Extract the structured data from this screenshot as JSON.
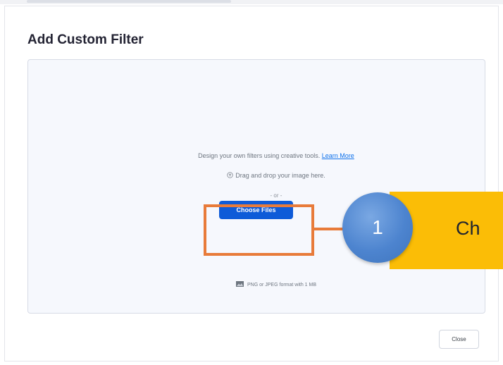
{
  "dialog": {
    "title": "Add Custom Filter",
    "close_label": "Close"
  },
  "dropzone": {
    "design_text": "Design your own filters using creative tools.",
    "learn_more_label": "Learn More",
    "drag_text": "Drag and drop your image here.",
    "or_text": "- or -",
    "choose_files_label": "Choose Files",
    "format_text": "PNG or JPEG format with 1 MB"
  },
  "overlay": {
    "step_number": "1",
    "callout_text": "Ch"
  },
  "colors": {
    "primary_button": "#0e5bd8",
    "link": "#0e71eb",
    "highlight": "#e87b3a",
    "callout": "#fbbd06",
    "badge": "#4d84cf"
  },
  "icons": {
    "upload": "cloud-upload-icon",
    "image": "image-icon"
  }
}
